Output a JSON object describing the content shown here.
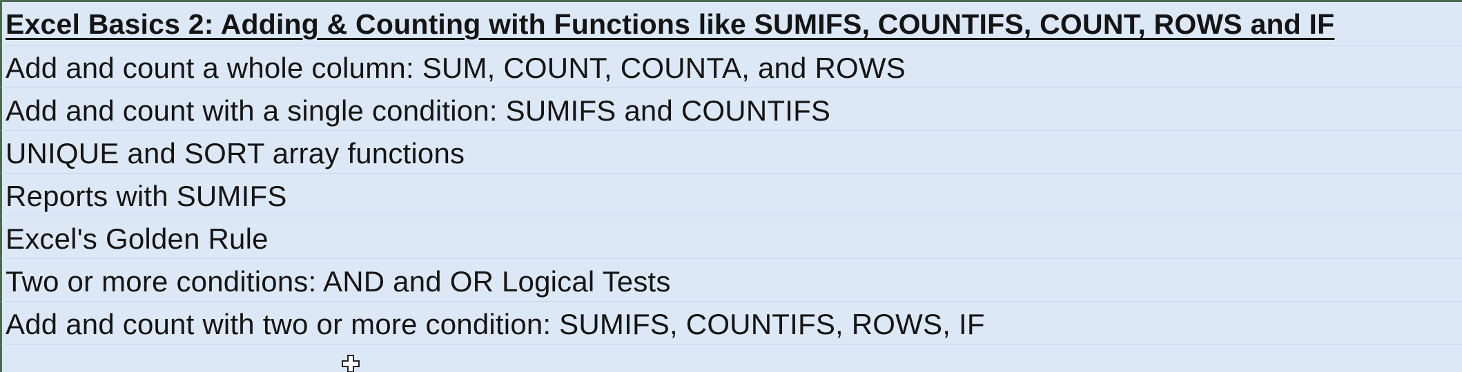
{
  "sheet": {
    "title": "Excel Basics 2: Adding & Counting with Functions like SUMIFS, COUNTIFS, COUNT, ROWS and IF",
    "items": [
      "Add and count a whole column: SUM, COUNT, COUNTA, and ROWS",
      "Add and count with a single condition: SUMIFS and COUNTIFS",
      "UNIQUE and SORT array functions",
      "Reports with SUMIFS",
      "Excel's Golden Rule",
      "Two or more  conditions: AND and OR Logical Tests",
      "Add and count with two or more condition: SUMIFS, COUNTIFS, ROWS, IF"
    ]
  },
  "colors": {
    "background": "#dde8f7",
    "text": "#141414",
    "edge": "#4a6a52"
  },
  "icons": {
    "cursor": "cell-select-cross-cursor-icon"
  }
}
